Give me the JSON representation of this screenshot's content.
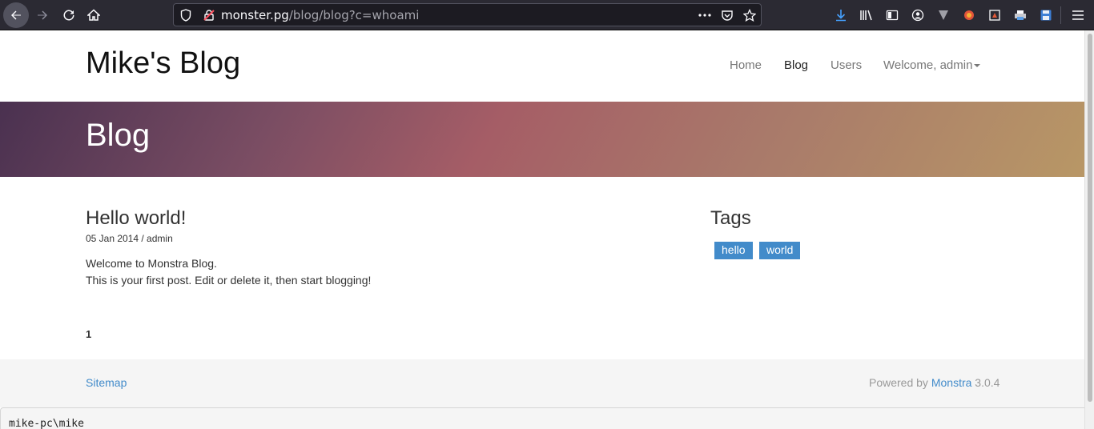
{
  "browser": {
    "url_host": "monster.pg",
    "url_path": "/blog/blog?c=whoami",
    "icons": [
      "back-icon",
      "forward-icon",
      "reload-icon",
      "home-icon",
      "shield-icon",
      "insecure-lock-icon",
      "more-icon",
      "pocket-icon",
      "bookmark-star-icon",
      "download-icon",
      "library-icon",
      "sidebar-icon",
      "account-icon",
      "extension-icon",
      "extension-icon",
      "extension-icon",
      "extension-icon",
      "save-icon",
      "menu-icon"
    ]
  },
  "site": {
    "title": "Mike's Blog",
    "nav": {
      "home": "Home",
      "blog": "Blog",
      "users": "Users",
      "welcome": "Welcome, admin"
    }
  },
  "banner": {
    "title": "Blog"
  },
  "post": {
    "title": "Hello world!",
    "meta": "05 Jan 2014 / admin",
    "line1": "Welcome to Monstra Blog.",
    "line2": "This is your first post. Edit or delete it, then start blogging!"
  },
  "pagination": {
    "current": "1"
  },
  "tags": {
    "title": "Tags",
    "items": [
      "hello",
      "world"
    ]
  },
  "footer": {
    "sitemap": "Sitemap",
    "powered_prefix": "Powered by",
    "powered_link": "Monstra",
    "version": "3.0.4"
  },
  "terminal": {
    "output": "mike-pc\\mike"
  },
  "colors": {
    "accent": "#428bca",
    "toolbar": "#2b2a33"
  }
}
